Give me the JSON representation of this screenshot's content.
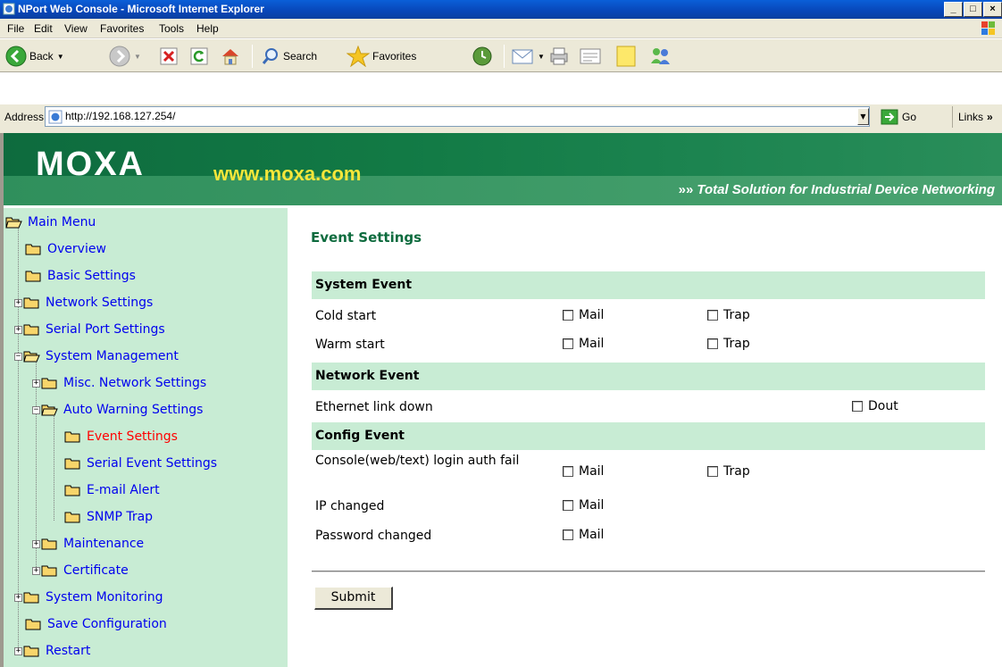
{
  "window": {
    "title": "NPort Web Console - Microsoft Internet Explorer",
    "controls": [
      "_",
      "□",
      "×"
    ]
  },
  "menubar": {
    "items": [
      {
        "label": "File"
      },
      {
        "label": "Edit"
      },
      {
        "label": "View"
      },
      {
        "label": "Favorites"
      },
      {
        "label": "Tools"
      },
      {
        "label": "Help"
      }
    ]
  },
  "toolbar": {
    "back_label": "Back",
    "search_label": "Search",
    "favorites_label": "Favorites"
  },
  "address": {
    "label": "Address",
    "url": "http://192.168.127.254/",
    "go_label": "Go",
    "links_label": "Links",
    "links_chevron": "»"
  },
  "header": {
    "logo": "MOXA",
    "site": "www.moxa.com",
    "tagline_chevron": "»»",
    "tagline": "Total Solution for Industrial Device Networking"
  },
  "sidebar": {
    "items": [
      {
        "label": "Main Menu"
      },
      {
        "label": "Overview"
      },
      {
        "label": "Basic Settings"
      },
      {
        "label": "Network Settings"
      },
      {
        "label": "Serial Port Settings"
      },
      {
        "label": "System Management"
      },
      {
        "label": "Misc. Network Settings"
      },
      {
        "label": "Auto Warning Settings"
      },
      {
        "label": "Event Settings"
      },
      {
        "label": "Serial Event Settings"
      },
      {
        "label": "E-mail Alert"
      },
      {
        "label": "SNMP Trap"
      },
      {
        "label": "Maintenance"
      },
      {
        "label": "Certificate"
      },
      {
        "label": "System Monitoring"
      },
      {
        "label": "Save Configuration"
      },
      {
        "label": "Restart"
      }
    ]
  },
  "main": {
    "title": "Event Settings",
    "sections": [
      {
        "label": "System Event"
      },
      {
        "label": "Network Event"
      },
      {
        "label": "Config Event"
      }
    ],
    "events": [
      {
        "label": "Cold start"
      },
      {
        "label": "Warm start"
      },
      {
        "label": "Ethernet link down"
      },
      {
        "label": "Console(web/text) login auth fail"
      },
      {
        "label": "IP changed"
      },
      {
        "label": "Password changed"
      }
    ],
    "options": {
      "mail": "Mail",
      "trap": "Trap",
      "dout": "Dout"
    },
    "submit_label": "Submit"
  }
}
